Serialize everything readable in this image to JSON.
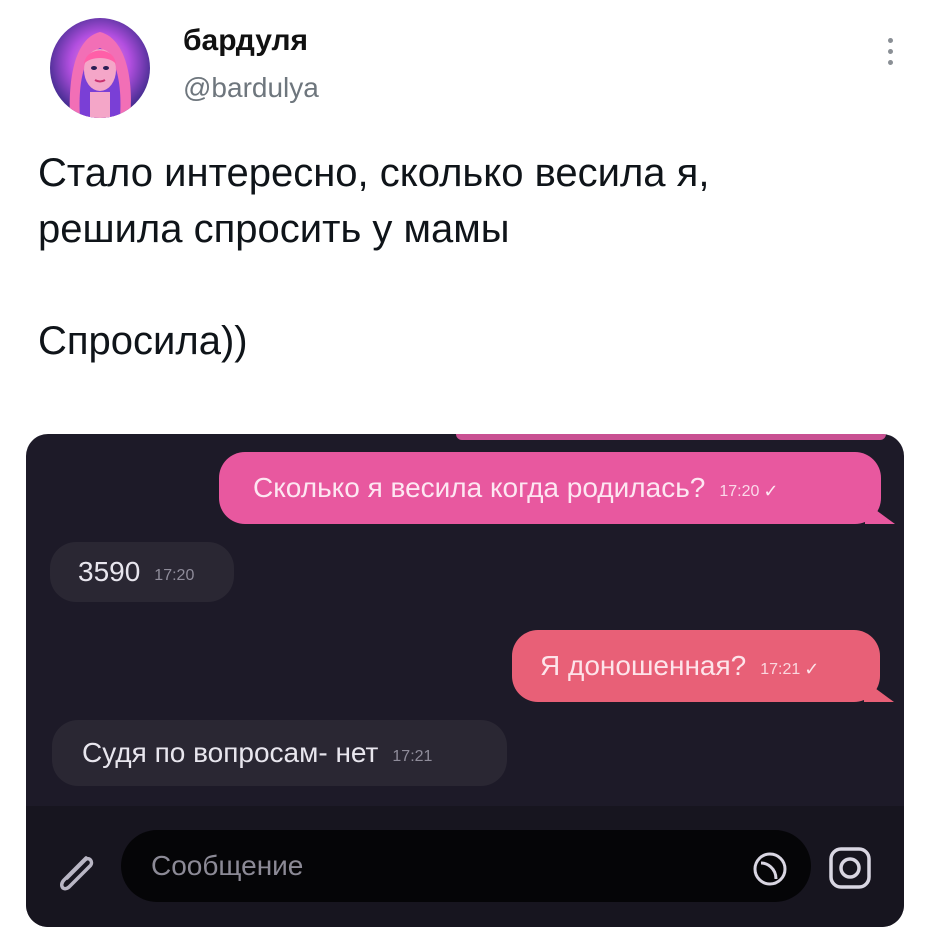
{
  "tweet": {
    "display_name": "бардуля",
    "handle": "@bardulya",
    "text_line1": "Стало интересно, сколько весила я,",
    "text_line2": "решила спросить у мамы",
    "text_line3": "Спросила))"
  },
  "chat": {
    "messages": [
      {
        "direction": "out",
        "text": "Сколько я весила когда родилась?",
        "time": "17:20",
        "status": "✓"
      },
      {
        "direction": "in",
        "text": "3590",
        "time": "17:20"
      },
      {
        "direction": "out",
        "text": "Я доношенная?",
        "time": "17:21",
        "status": "✓"
      },
      {
        "direction": "in",
        "text": "Судя по вопросам- нет",
        "time": "17:21"
      }
    ],
    "composer": {
      "placeholder": "Сообщение"
    }
  },
  "icons": {
    "more": "more-vertical-icon",
    "attach": "paperclip-icon",
    "sticker": "sticker-icon",
    "camera": "camera-icon"
  },
  "colors": {
    "outgoing_bubble_1": "#e8589f",
    "outgoing_bubble_2": "#e86077",
    "incoming_bubble": "#2a2733",
    "chat_background": "#1d1a28"
  }
}
